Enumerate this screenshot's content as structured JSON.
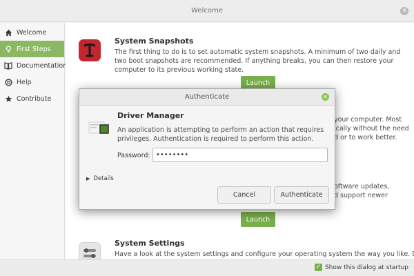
{
  "window": {
    "title": "Welcome",
    "close_icon": "close-icon"
  },
  "sidebar": {
    "items": [
      {
        "label": "Welcome",
        "icon": "home-icon",
        "active": false
      },
      {
        "label": "First Steps",
        "icon": "lightbulb-icon",
        "active": true
      },
      {
        "label": "Documentation",
        "icon": "book-icon",
        "active": false
      },
      {
        "label": "Help",
        "icon": "lifebuoy-icon",
        "active": false
      },
      {
        "label": "Contribute",
        "icon": "star-icon",
        "active": false
      }
    ]
  },
  "main": {
    "snapshots": {
      "title": "System Snapshots",
      "text": "The first thing to do is to set automatic system snapshots. A minimum of two daily and two boot snapshots are recommended. If anything breaks, you can then restore your computer to its previous working state.",
      "button": "Launch"
    },
    "drivers_partial": {
      "line1": "your computer. Most",
      "line2": "ically without the need",
      "line3": "d or to work better."
    },
    "updates_partial": {
      "line1": "oftware updates,",
      "line2": "d support newer",
      "button": "Launch"
    },
    "settings": {
      "title": "System Settings",
      "text": "Have a look at the system settings and configure your operating system the way you like. Don't"
    }
  },
  "footer": {
    "startup_label": "Show this dialog at startup",
    "startup_checked": true
  },
  "dialog": {
    "title": "Authenticate",
    "heading": "Driver Manager",
    "message": "An application is attempting to perform an action that requires privileges. Authentication is required to perform this action.",
    "password_label": "Password:",
    "password_value": "••••••••",
    "details_label": "Details",
    "cancel_label": "Cancel",
    "authenticate_label": "Authenticate"
  },
  "colors": {
    "accent": "#79b049",
    "sidebar_active": "#8db863",
    "snapshot_icon": "#c2272d"
  }
}
